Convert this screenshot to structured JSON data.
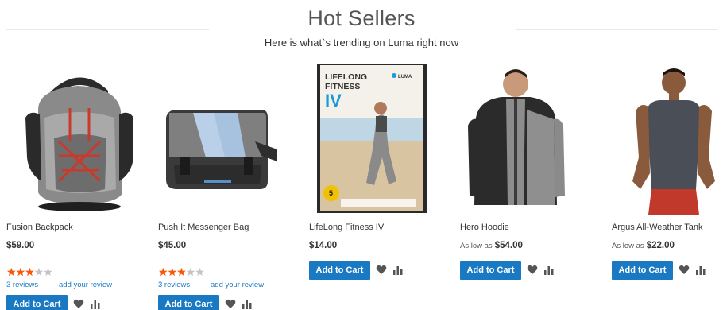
{
  "section": {
    "title": "Hot Sellers",
    "subtitle": "Here is what`s trending on Luma right now"
  },
  "products": [
    {
      "name": "Fusion Backpack",
      "price_prefix": "",
      "price": "$59.00",
      "rating_fraction": 0.6,
      "reviews_label": "3  reviews",
      "add_review_label": "add your review",
      "add_to_cart_label": "Add to Cart",
      "image_icon": "backpack-image"
    },
    {
      "name": "Push It Messenger Bag",
      "price_prefix": "",
      "price": "$45.00",
      "rating_fraction": 0.6,
      "reviews_label": "3  reviews",
      "add_review_label": "add your review",
      "add_to_cart_label": "Add to Cart",
      "image_icon": "messenger-bag-image"
    },
    {
      "name": "LifeLong Fitness IV",
      "price_prefix": "",
      "price": "$14.00",
      "add_to_cart_label": "Add to Cart",
      "image_icon": "dvd-cover-image",
      "dvd": {
        "title_line1": "LIFELONG",
        "title_line2": "FITNESS",
        "title_line3": "IV",
        "brand": "LUMA",
        "badge": "5"
      }
    },
    {
      "name": "Hero Hoodie",
      "price_prefix": "As low as",
      "price": "$54.00",
      "add_to_cart_label": "Add to Cart",
      "image_icon": "hoodie-image"
    },
    {
      "name": "Argus All-Weather Tank",
      "price_prefix": "As low as",
      "price": "$22.00",
      "add_to_cart_label": "Add to Cart",
      "image_icon": "tank-top-image"
    }
  ],
  "colors": {
    "primary_button": "#1979c3",
    "rating_star": "#ff5501",
    "link": "#1979c3"
  }
}
